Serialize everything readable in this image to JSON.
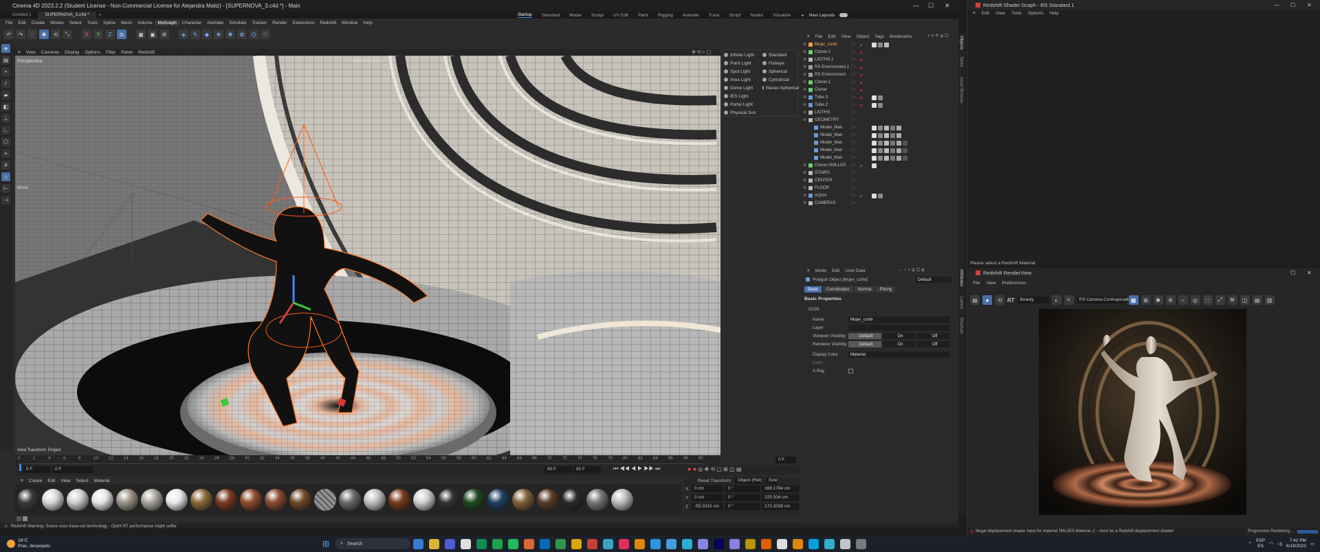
{
  "c4d": {
    "title": "Cinema 4D 2023.2.2 (Student License - Non-Commercial License for Alejandra Matiz) - [SUPERNOVA_3.c4d *] - Main",
    "doc_tabs": [
      "Untitled 1",
      "SUPERNOVA_3.c4d *"
    ],
    "layouts": [
      "Startup",
      "Standard",
      "Model",
      "Sculpt",
      "UV Edit",
      "Paint",
      "Rigging",
      "Animate",
      "Track",
      "Script",
      "Nodes",
      "Visualize"
    ],
    "new_layouts": "New Layouts",
    "menu": [
      "File",
      "Edit",
      "Create",
      "Modes",
      "Select",
      "Tools",
      "Spline",
      "Mesh",
      "Volume",
      "MoGraph",
      "Character",
      "Animate",
      "Simulate",
      "Tracker",
      "Render",
      "Extensions",
      "Redshift",
      "Window",
      "Help"
    ],
    "menu_highlight": "MoGraph",
    "toolbar_icons": [
      "undo-icon",
      "redo-icon",
      "live-selection-icon",
      "move-icon",
      "rotate-icon",
      "scale-icon",
      "x-axis-icon",
      "y-axis-icon",
      "z-axis-icon",
      "coordinate-icon",
      "render-region-icon",
      "render-view-icon",
      "render-settings-icon",
      "cube-icon",
      "pen-icon",
      "subdivision-icon",
      "cloner-icon",
      "deformer-icon",
      "field-icon",
      "camera-icon",
      "light-icon"
    ],
    "toolbar_axes": [
      "X",
      "Y",
      "Z"
    ],
    "viewport_menu": [
      "View",
      "Cameras",
      "Display",
      "Options",
      "Filter",
      "Panel",
      "Redshift"
    ],
    "viewport_name": "Perspective",
    "camera_label": "Default Camera",
    "move_label": "Move",
    "view_transform": "View Transform: Project",
    "light_menu": {
      "left": [
        "Infinite Light",
        "Point Light",
        "Spot Light",
        "Area Light",
        "Dome Light",
        "IES Light",
        "Portal Light",
        "Physical Sun"
      ],
      "right": [
        "Standard",
        "Fisheye",
        "Spherical",
        "Cylindrical",
        "Stereo-Spherical"
      ]
    },
    "timeline": {
      "ticks": [
        "0",
        "2",
        "4",
        "6",
        "8",
        "10",
        "12",
        "14",
        "16",
        "18",
        "20",
        "22",
        "24",
        "26",
        "28",
        "30",
        "32",
        "34",
        "36",
        "38",
        "40",
        "42",
        "44",
        "46",
        "48",
        "50",
        "52",
        "54",
        "56",
        "58",
        "60",
        "62",
        "64",
        "66",
        "68",
        "70",
        "72",
        "74",
        "76",
        "78",
        "80",
        "82",
        "84",
        "86",
        "88",
        "90"
      ],
      "current": "0 F",
      "start": "0 F",
      "end_a": "90 F",
      "end_b": "90 F",
      "frame_right": "0 F"
    },
    "material_menu": [
      "Create",
      "Edit",
      "View",
      "Select",
      "Material"
    ],
    "materials": [
      "#3a3a3a",
      "#d8d8d8",
      "#cfcfcf",
      "#e6e6e6",
      "#9c9488",
      "#a9a69e",
      "#eaeaea",
      "#8a6a3a",
      "#7a3a22",
      "#8e4a2c",
      "#8a4a30",
      "#6e4a2a",
      "#8e8e8e",
      "#6a6a6a",
      "#c0c0c0",
      "#7a3a1e",
      "#cfcfcf",
      "#333333",
      "#1e4a22",
      "#1f4060",
      "#80603a",
      "#5a3a28",
      "#2a2a2a",
      "#777777",
      "#bcbcbc"
    ],
    "coords": {
      "reset_label": "Reset Transform",
      "object_label": "Object (Rel)",
      "size_label": "Size",
      "rows": [
        {
          "axis": "X",
          "pos": "0 cm",
          "rot": "0 °",
          "size": "169.1784 cm"
        },
        {
          "axis": "Y",
          "pos": "0 cm",
          "rot": "0 °",
          "size": "225.504 cm"
        },
        {
          "axis": "Z",
          "pos": "-55.0315 cm",
          "rot": "0 °",
          "size": "172.2026 cm"
        }
      ]
    },
    "status": "Redshift Warning: Scene uses trace-set technology - OptiX RT performance might suffer"
  },
  "objects": {
    "menu": [
      "File",
      "Edit",
      "View",
      "Object",
      "Tags",
      "Bookmarks"
    ],
    "rows": [
      {
        "name": "Mujer_corte",
        "indent": 0,
        "sel": true,
        "check": "✓",
        "icolor": "#f0a040"
      },
      {
        "name": "Cloner.2",
        "indent": 0,
        "check": "✕",
        "icolor": "#6cd06c"
      },
      {
        "name": "LIGTHS.1",
        "indent": 0,
        "check": "✕",
        "icolor": "#bbbbbb"
      },
      {
        "name": "RS Environment.1",
        "indent": 0,
        "check": "✕",
        "icolor": "#9aa0a8"
      },
      {
        "name": "RS Environment",
        "indent": 0,
        "check": "✕",
        "icolor": "#9aa0a8"
      },
      {
        "name": "Cloner.1",
        "indent": 0,
        "check": "✕",
        "icolor": "#6cd06c"
      },
      {
        "name": "Cloner",
        "indent": 0,
        "check": "✕",
        "icolor": "#6cd06c"
      },
      {
        "name": "Tube.3",
        "indent": 0,
        "check": "✕",
        "icolor": "#6a9cd8"
      },
      {
        "name": "Tube.2",
        "indent": 0,
        "check": "✕",
        "icolor": "#6a9cd8"
      },
      {
        "name": "LIGTHS",
        "indent": 0,
        "check": "",
        "icolor": "#bbbbbb"
      },
      {
        "name": "GEOMETRY",
        "indent": 0,
        "check": "",
        "icolor": "#bbbbbb"
      },
      {
        "name": "Model_Man",
        "indent": 1,
        "check": "",
        "icolor": "#6a9cd8"
      },
      {
        "name": "Model_Man",
        "indent": 1,
        "check": "",
        "icolor": "#6a9cd8"
      },
      {
        "name": "Model_Man",
        "indent": 1,
        "check": "",
        "icolor": "#6a9cd8"
      },
      {
        "name": "Model_Man",
        "indent": 1,
        "check": "",
        "icolor": "#6a9cd8"
      },
      {
        "name": "Model_Man",
        "indent": 1,
        "check": "",
        "icolor": "#6a9cd8"
      },
      {
        "name": "Cloner.ANILLOS",
        "indent": 0,
        "check": "✓",
        "icolor": "#6cd06c"
      },
      {
        "name": "STAIRS",
        "indent": 0,
        "check": "",
        "icolor": "#bbbbbb"
      },
      {
        "name": "CENTER",
        "indent": 0,
        "check": "",
        "icolor": "#bbbbbb"
      },
      {
        "name": "FLOOR",
        "indent": 0,
        "check": "",
        "icolor": "#bbbbbb"
      },
      {
        "name": "AQUA",
        "indent": 0,
        "check": "✓",
        "icolor": "#6a9cd8"
      },
      {
        "name": "CAMERAS",
        "indent": 0,
        "check": "",
        "icolor": "#bbbbbb"
      }
    ]
  },
  "attributes": {
    "menu": [
      "Mode",
      "Edit",
      "User Data"
    ],
    "object": "Polygon Object [Mujer_corte]",
    "preset": "Default",
    "tabs": [
      "Basic",
      "Coordinates",
      "Normal",
      "Phong"
    ],
    "section": "Basic Properties",
    "icon_label": "ICON",
    "name_label": "Name",
    "name_value": "Mujer_corte",
    "layer_label": "Layer",
    "viewport_vis": "Viewport Visibility",
    "render_vis": "Renderer Visibility",
    "vis_opts": [
      "Default",
      "On",
      "Off"
    ],
    "display_color_label": "Display Color",
    "display_color_value": "Material",
    "color_label": "Color",
    "xray_label": "X-Ray"
  },
  "side_tabs": [
    "Objects",
    "Takes",
    "Asset Browser",
    "Attributes",
    "Layers",
    "Structure"
  ],
  "shader_graph": {
    "title": "Redshift Shader Graph - RS Standard.1",
    "menu": [
      "Edit",
      "View",
      "Tools",
      "Options",
      "Help"
    ],
    "status": "Please select a Redshift Material"
  },
  "render_view": {
    "title": "Redshift RenderView",
    "menu": [
      "File",
      "View",
      "Preferences"
    ],
    "aov": "Beauty",
    "camera": "RS Camera.Contrapicado",
    "rt": "RT",
    "error": "Illegal displacement shader input for material 'IMUJES Material..1' - must be a Redshift displacement shader!",
    "progress_label": "Progressive Rendering..."
  },
  "taskbar": {
    "temp": "16°C",
    "weather": "Prac. despejado",
    "search": "Search",
    "lang": "ESP",
    "region": "ES",
    "time": "7:42 PM",
    "date": "6/19/2023",
    "apps": [
      "#3b8cf0",
      "#ffcc33",
      "#5865f2",
      "#ffffff",
      "#0f9d58",
      "#1db954",
      "#25d366",
      "#ff7139",
      "#0078d4",
      "#34a853",
      "#fbbc04",
      "#ea4335",
      "#3fb8e0",
      "#ff3366",
      "#ff9a00",
      "#31a8ff",
      "#4bb3ff",
      "#31c5f0",
      "#9999ff",
      "#00005b",
      "#9f8fff",
      "#d2a800",
      "#ff6a00",
      "#ffffff",
      "#ff9900",
      "#00b4ff",
      "#36c5f0",
      "#e0e0e0",
      "#888888"
    ]
  }
}
